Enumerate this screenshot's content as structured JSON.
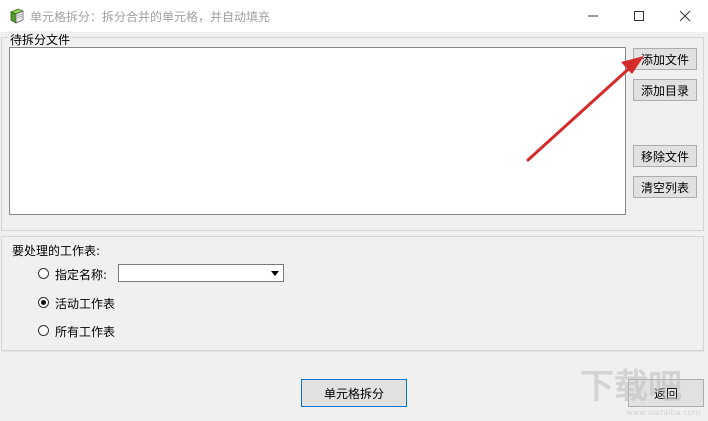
{
  "window": {
    "title": "单元格拆分：拆分合并的单元格，并自动填充",
    "icon": "app-book-icon",
    "controls": [
      "minimize-icon",
      "maximize-icon",
      "close-icon"
    ]
  },
  "files_group": {
    "title": "待拆分文件",
    "add_file_label": "添加文件",
    "add_dir_label": "添加目录",
    "remove_file_label": "移除文件",
    "clear_list_label": "清空列表"
  },
  "sheets_group": {
    "heading": "要处理的工作表:",
    "options": [
      {
        "label": "指定名称:",
        "checked": false
      },
      {
        "label": "活动工作表",
        "checked": true
      },
      {
        "label": "所有工作表",
        "checked": false
      }
    ],
    "name_select_value": ""
  },
  "actions": {
    "split_label": "单元格拆分",
    "back_label": "返回"
  },
  "annotation": {
    "arrow_color": "#d42a2a"
  },
  "watermark": {
    "text": "下载吧",
    "url": "www.xiazaiba.com"
  }
}
